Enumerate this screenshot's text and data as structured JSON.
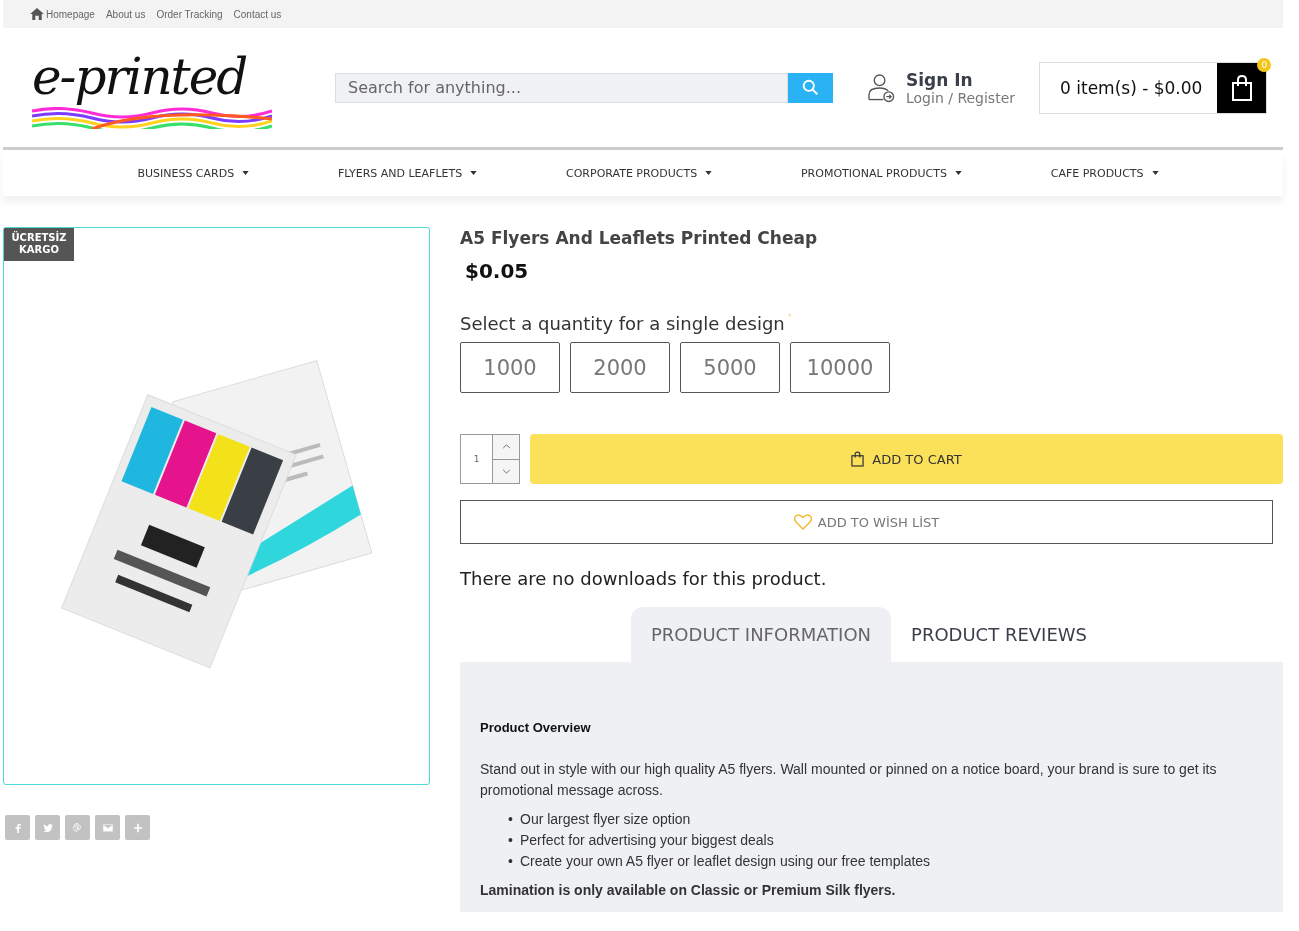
{
  "top_links": [
    "Homepage",
    "About us",
    "Order Tracking",
    "Contact us"
  ],
  "logo": "e-printed",
  "search": {
    "placeholder": "Search for anything..."
  },
  "account": {
    "title": "Sign In",
    "subtitle": "Login / Register"
  },
  "cart": {
    "summary": "0 item(s) - $0.00",
    "count": "0"
  },
  "nav": [
    "BUSINESS CARDS",
    "FLYERS AND LEAFLETS",
    "CORPORATE PRODUCTS",
    "PROMOTIONAL PRODUCTS",
    "CAFE PRODUCTS"
  ],
  "product": {
    "badge": "ÜCRETSİZ KARGO",
    "title": "A5 Flyers And Leaflets Printed Cheap",
    "price": "$0.05",
    "quantity_label": "Select a quantity for a single design",
    "required_mark": "*",
    "quantities": [
      {
        "label": "1000",
        "selected": false
      },
      {
        "label": "2000",
        "selected": false
      },
      {
        "label": "5000",
        "selected": false
      },
      {
        "label": "10000",
        "selected": false
      }
    ],
    "qty": "1",
    "add_to_cart": "ADD TO CART",
    "wishlist": "ADD TO WİSH LİST",
    "downloads_note": "There are no downloads for this product."
  },
  "share": [
    {
      "kind": "facebook"
    },
    {
      "kind": "twitter"
    },
    {
      "kind": "pinterest"
    },
    {
      "kind": "email"
    },
    {
      "kind": "more"
    }
  ],
  "tabs": [
    {
      "label": "PRODUCT INFORMATION",
      "selected": true
    },
    {
      "label": "PRODUCT REVIEWS",
      "selected": false
    }
  ],
  "description": {
    "heading": "Product Overview",
    "intro": "Stand out in style with our high quality A5 flyers. Wall mounted or pinned on a notice board, your brand is sure to get its promotional message across.",
    "bullet_mark": "•",
    "bullets": [
      "Our largest flyer size option",
      "Perfect for advertising your biggest deals",
      "Create your own A5 flyer or leaflet design using our free templates"
    ],
    "note": "Lamination is only available on Classic or Premium Silk flyers."
  }
}
